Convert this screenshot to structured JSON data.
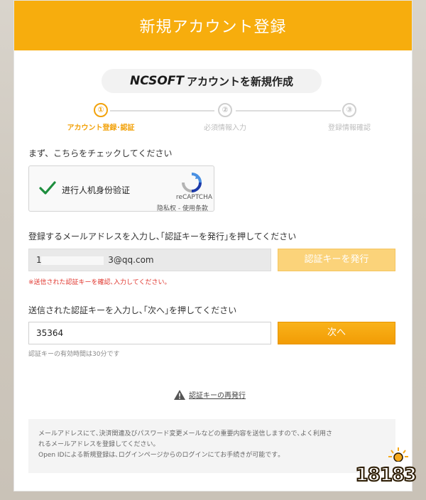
{
  "header": {
    "title": "新規アカウント登録"
  },
  "brand": {
    "logo": "NCSOFT",
    "text": "アカウントを新規作成"
  },
  "steps": [
    {
      "num": "①",
      "label": "アカウント登録･認証",
      "active": true
    },
    {
      "num": "②",
      "label": "必須情報入力",
      "active": false
    },
    {
      "num": "③",
      "label": "登録情報確認",
      "active": false
    }
  ],
  "captcha": {
    "instruction": "まず、こちらをチェックしてください",
    "label": "进行人机身份验证",
    "brand": "reCAPTCHA",
    "links": "隐私权 - 使用条款",
    "checked": true
  },
  "email": {
    "instruction": "登録するメールアドレスを入力し､｢認証キーを発行｣を押してください",
    "value_prefix": "1",
    "value_suffix": "3@qq.com",
    "button": "認証キーを発行",
    "error": "※送信された認証キーを確認､入力してください｡"
  },
  "code": {
    "instruction": "送信された認証キーを入力し､｢次へ｣を押してください",
    "value": "35364",
    "button": "次へ",
    "validity": "認証キーの有効時間は30分です"
  },
  "resend": {
    "link": "認証キーの再発行",
    "icon": "warning-icon"
  },
  "notice": {
    "line1": "メールアドレスにて､決済関連及びパスワード変更メールなどの重要内容を送信しますので､よく利用さ",
    "line2": "れるメールアドレスを登録してください｡",
    "line3": "Open IDによる新規登録は､ログインページからのログインにてお手続きが可能です｡"
  },
  "watermark": {
    "text": "18183"
  },
  "colors": {
    "accent": "#f7ad0d",
    "button": "#f29c05",
    "button_disabled": "#fbd37a",
    "error": "#e0362e"
  }
}
